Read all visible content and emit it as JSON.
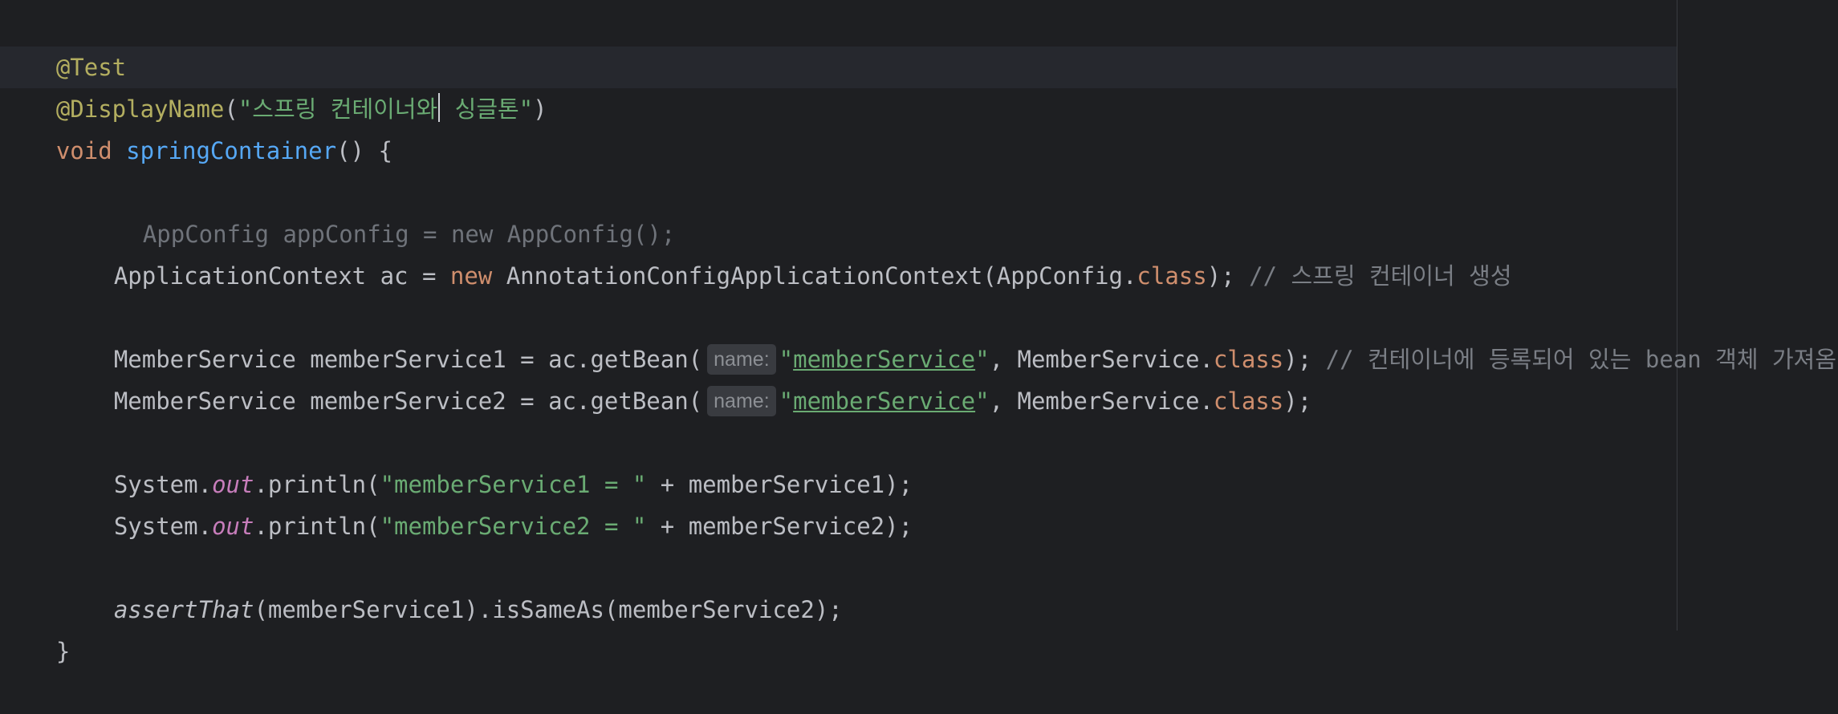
{
  "editor": {
    "lines": {
      "l1": {
        "annotation": "@Test"
      },
      "l2": {
        "annotation": "@DisplayName",
        "open": "(",
        "string_before_caret": "\"스프링 컨테이너와",
        "string_after_caret": " 싱글톤\"",
        "close": ")"
      },
      "l3": {
        "kw": "void",
        "sp": " ",
        "method": "springContainer",
        "rest": "() {"
      },
      "l4": {
        "faded_code": "AppConfig appConfig = new AppConfig();"
      },
      "l5": {
        "a": "ApplicationContext ac = ",
        "kw_new": "new",
        "b": " AnnotationConfigApplicationContext(AppConfig.",
        "kw_class": "class",
        "c": "); ",
        "comment": "// 스프링 컨테이너 생성"
      },
      "l6": {
        "a": "MemberService memberService1 = ac.getBean(",
        "hint": "name:",
        "q1": "\"",
        "str": "memberService",
        "q2": "\"",
        "b": ", MemberService.",
        "kw_class": "class",
        "c": "); ",
        "comment": "// 컨테이너에 등록되어 있는 bean 객체 가져옴"
      },
      "l7": {
        "a": "MemberService memberService2 = ac.getBean(",
        "hint": "name:",
        "q1": "\"",
        "str": "memberService",
        "q2": "\"",
        "b": ", MemberService.",
        "kw_class": "class",
        "c": ");"
      },
      "l8": {
        "a": "System.",
        "out": "out",
        "b": ".println(",
        "str": "\"memberService1 = \"",
        "c": " + memberService1);"
      },
      "l9": {
        "a": "System.",
        "out": "out",
        "b": ".println(",
        "str": "\"memberService2 = \"",
        "c": " + memberService2);"
      },
      "l10": {
        "ital": "assertThat",
        "rest": "(memberService1).isSameAs(memberService2);"
      },
      "l11": {
        "brace": "}"
      }
    }
  }
}
